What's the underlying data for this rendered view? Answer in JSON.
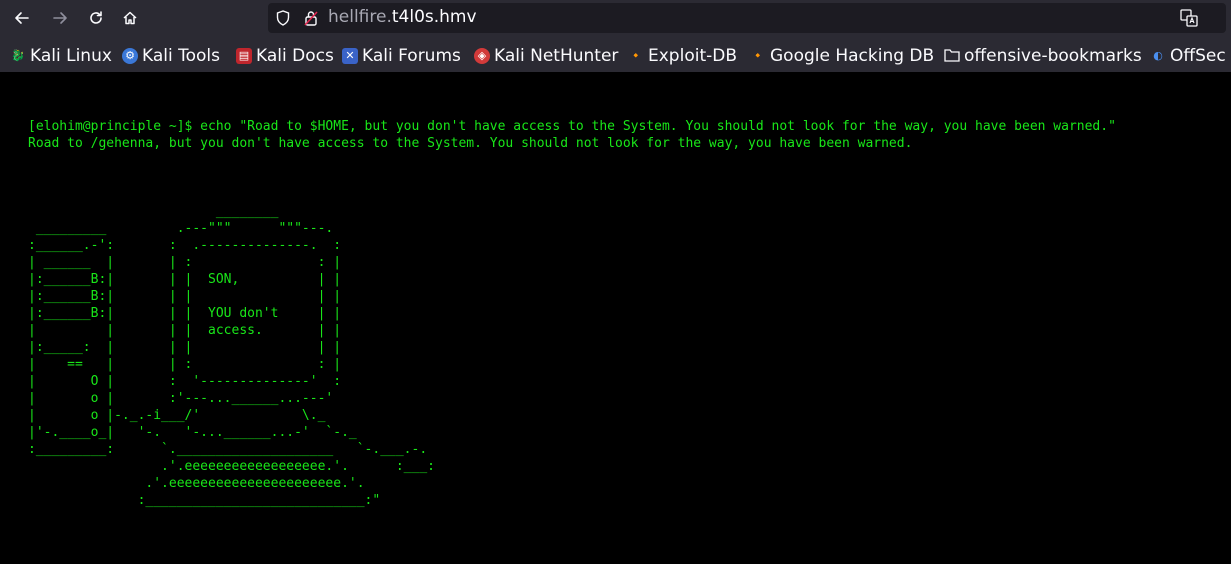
{
  "browser": {
    "url_host_prefix": "hellfire.",
    "url_host_main": "t4l0s.hmv",
    "bookmarks": [
      {
        "label": "Kali Linux",
        "icon": "kali-dragon-icon"
      },
      {
        "label": "Kali Tools",
        "icon": "kali-tools-icon"
      },
      {
        "label": "Kali Docs",
        "icon": "kali-docs-icon"
      },
      {
        "label": "Kali Forums",
        "icon": "kali-forums-icon"
      },
      {
        "label": "Kali NetHunter",
        "icon": "kali-nethunter-icon"
      },
      {
        "label": "Exploit-DB",
        "icon": "exploit-db-icon"
      },
      {
        "label": "Google Hacking DB",
        "icon": "ghdb-icon"
      },
      {
        "label": "offensive-bookmarks",
        "icon": "folder-icon"
      },
      {
        "label": "OffSec",
        "icon": "offsec-icon"
      }
    ],
    "colors": {
      "chrome_bg": "#2b2a33",
      "urlbar_bg": "#1c1b22",
      "terminal_green": "#19e619",
      "page_bg": "#000000"
    }
  },
  "page": {
    "command_line": "[elohim@principle ~]$ echo \"Road to $HOME, but you don't have access to the System. You should not look for the way, you have been warned.\"",
    "output_line": "Road to /gehenna, but you don't have access to the System. You should not look for the way, you have been warned.",
    "ascii_art": "                        ________\n _________         .---\"\"\"      \"\"\"---.\n:______.-':       :  .--------------.  :\n| ______  |       | :                : |\n|:______B:|       | |  SON,          | |\n|:______B:|       | |                | |\n|:______B:|       | |  YOU don't     | |\n|         |       | |  access.       | |\n|:_____:  |       | |                | |\n|    ==   |       | :                : |\n|       O |       :  '--------------'  :\n|       o |       :'---...______...---'\n|       o |-._.-i___/'             \\._\n|'-.____o_|   '-.   '-...______...-'  `-._\n:_________:      `.____________________   `-.___.-.\n                 .'.eeeeeeeeeeeeeeeeee.'.      :___:\n               .'.eeeeeeeeeeeeeeeeeeeeee.'.\n              :____________________________:\""
  }
}
